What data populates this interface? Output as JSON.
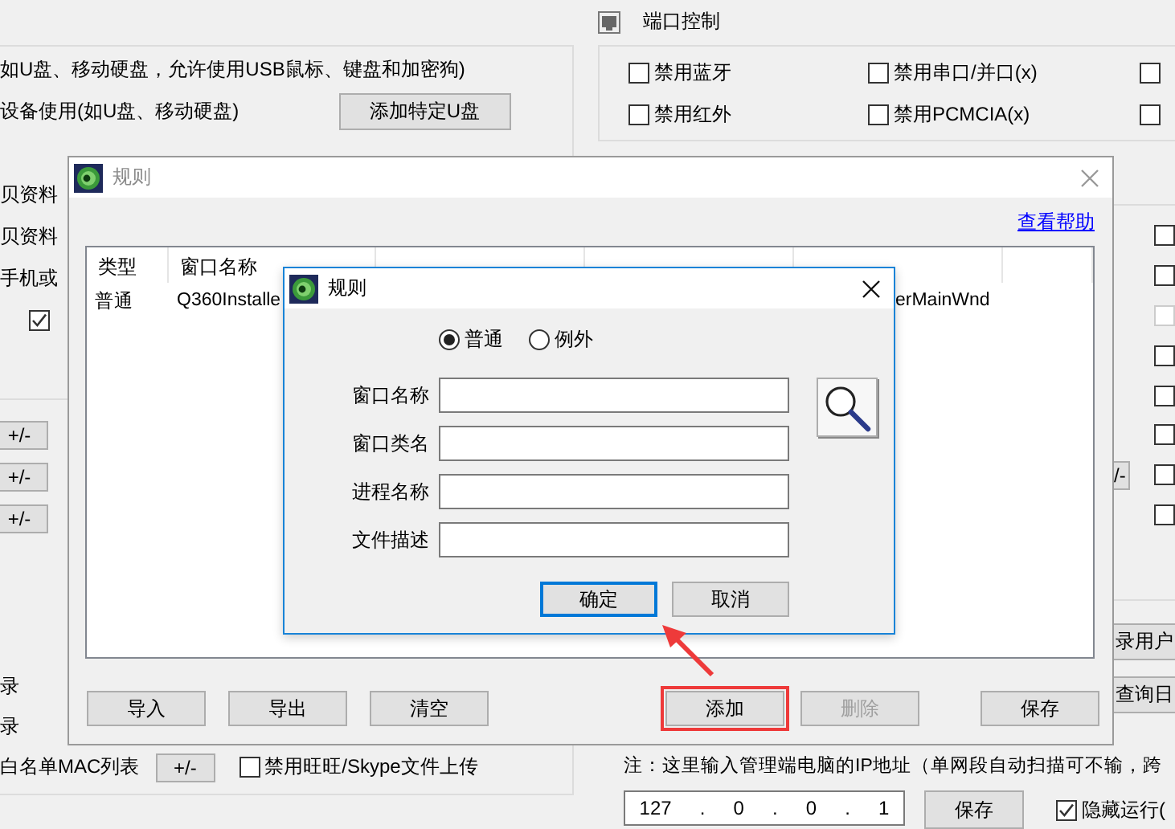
{
  "app": {
    "left_panel": {
      "lines": [
        {
          "kind": "text",
          "text": "如U盘、移动硬盘，允许使用USB鼠标、键盘和加密狗)"
        },
        {
          "kind": "text_button",
          "text": "设备使用(如U盘、移动硬盘)",
          "button": "添加特定U盘"
        },
        {
          "kind": "blank"
        },
        {
          "kind": "text",
          "text": "贝资料"
        },
        {
          "kind": "text",
          "text": "贝资料"
        },
        {
          "kind": "text",
          "text": "手机或"
        },
        {
          "kind": "checkbox",
          "checked": true
        }
      ],
      "plus_buttons": [
        "+/-",
        "+/-",
        "+/-"
      ],
      "lower_lines": [
        "录",
        "录"
      ],
      "mac_row": {
        "label": "白名单MAC列表",
        "button": "+/-",
        "checkbox": {
          "label": "禁用旺旺/Skype文件上传",
          "checked": false
        }
      }
    },
    "port_control": {
      "title": "端口控制",
      "options": [
        {
          "label": "禁用蓝牙",
          "checked": false
        },
        {
          "label": "禁用串口/并口(x)",
          "checked": false
        },
        {
          "checked": false
        },
        {
          "label": "禁用红外",
          "checked": false
        },
        {
          "label": "禁用PCMCIA(x)",
          "checked": false
        },
        {
          "checked": false
        }
      ]
    },
    "right_checkboxes": [
      {
        "checked": false,
        "disabled": false
      },
      {
        "checked": false,
        "disabled": false
      },
      {
        "checked": false,
        "disabled": true
      },
      {
        "checked": false,
        "disabled": false
      },
      {
        "checked": false,
        "disabled": false
      },
      {
        "checked": false,
        "disabled": false
      },
      {
        "checked": false,
        "disabled": false
      },
      {
        "checked": false,
        "disabled": false
      }
    ],
    "right_small_button": "/-",
    "right_buttons": [
      "录用户",
      "查询日"
    ],
    "note": "注：这里输入管理端电脑的IP地址（单网段自动扫描可不输，跨",
    "ip": [
      "127",
      "0",
      "0",
      "1"
    ],
    "ip_separator": ".",
    "save_button": "保存",
    "hide_run": {
      "label": "隐藏运行(",
      "checked": true
    }
  },
  "rules_dialog": {
    "title": "规则",
    "active": false,
    "help_link": "查看帮助",
    "columns": [
      "类型",
      "窗口名称"
    ],
    "rows": [
      {
        "type": "普通",
        "window_name": "Q360Installe",
        "file_description": "erMainWnd"
      }
    ],
    "left_buttons": [
      {
        "label": "导入",
        "disabled": false
      },
      {
        "label": "导出",
        "disabled": false
      },
      {
        "label": "清空",
        "disabled": false
      }
    ],
    "middle_buttons": [
      {
        "label": "添加",
        "disabled": false,
        "highlighted": true
      },
      {
        "label": "删除",
        "disabled": true,
        "highlighted": false
      }
    ],
    "right_buttons": [
      {
        "label": "保存",
        "disabled": false
      }
    ]
  },
  "rule_editor": {
    "title": "规则",
    "active": true,
    "types": [
      {
        "label": "普通",
        "selected": true
      },
      {
        "label": "例外",
        "selected": false
      }
    ],
    "fields": [
      "窗口名称",
      "窗口类名",
      "进程名称",
      "文件描述"
    ],
    "buttons": [
      {
        "label": "确定",
        "default": true
      },
      {
        "label": "取消",
        "default": false
      }
    ]
  }
}
